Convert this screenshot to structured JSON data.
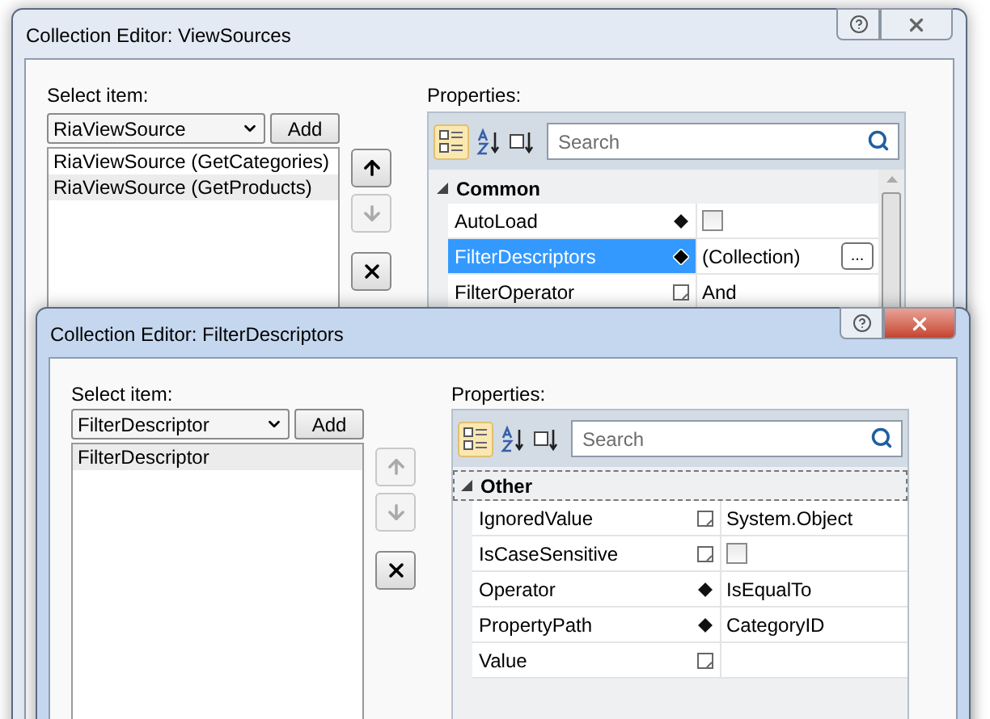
{
  "windows": [
    {
      "title": "Collection Editor: ViewSources",
      "active": false,
      "select_label": "Select item:",
      "type_dropdown": "RiaViewSource",
      "add_button": "Add",
      "items": [
        {
          "label": "RiaViewSource (GetCategories)",
          "selected": false
        },
        {
          "label": "RiaViewSource (GetProducts)",
          "selected": true
        }
      ],
      "move_up": {
        "disabled": false
      },
      "move_down": {
        "disabled": true
      },
      "remove": {
        "disabled": false
      },
      "properties_label": "Properties:",
      "search": {
        "placeholder": "Search"
      },
      "category": {
        "name": "Common",
        "expanded": true,
        "focused": false
      },
      "properties": [
        {
          "name": "AutoLoad",
          "marker": {
            "kind": "diamond"
          },
          "kind": "checkbox",
          "checked": false,
          "selected": false
        },
        {
          "name": "FilterDescriptors",
          "marker": {
            "kind": "diamond"
          },
          "kind": "collection",
          "value": "(Collection)",
          "button": "...",
          "selected": true
        },
        {
          "name": "FilterOperator",
          "marker": {
            "kind": "square"
          },
          "kind": "text",
          "value": "And",
          "selected": false
        }
      ],
      "scrollbar": true
    },
    {
      "title": "Collection Editor: FilterDescriptors",
      "active": true,
      "select_label": "Select item:",
      "type_dropdown": "FilterDescriptor",
      "add_button": "Add",
      "items": [
        {
          "label": "FilterDescriptor",
          "selected": true
        }
      ],
      "move_up": {
        "disabled": true
      },
      "move_down": {
        "disabled": true
      },
      "remove": {
        "disabled": false
      },
      "properties_label": "Properties:",
      "search": {
        "placeholder": "Search"
      },
      "category": {
        "name": "Other",
        "expanded": true,
        "focused": true
      },
      "properties": [
        {
          "name": "IgnoredValue",
          "marker": {
            "kind": "square"
          },
          "kind": "text",
          "value": "System.Object",
          "selected": false
        },
        {
          "name": "IsCaseSensitive",
          "marker": {
            "kind": "square"
          },
          "kind": "checkbox",
          "checked": false,
          "selected": false
        },
        {
          "name": "Operator",
          "marker": {
            "kind": "diamond"
          },
          "kind": "text",
          "value": "IsEqualTo",
          "selected": false
        },
        {
          "name": "PropertyPath",
          "marker": {
            "kind": "diamond"
          },
          "kind": "text",
          "value": "CategoryID",
          "selected": false
        },
        {
          "name": "Value",
          "marker": {
            "kind": "square"
          },
          "kind": "text",
          "selected": false
        }
      ],
      "scrollbar": false
    }
  ]
}
